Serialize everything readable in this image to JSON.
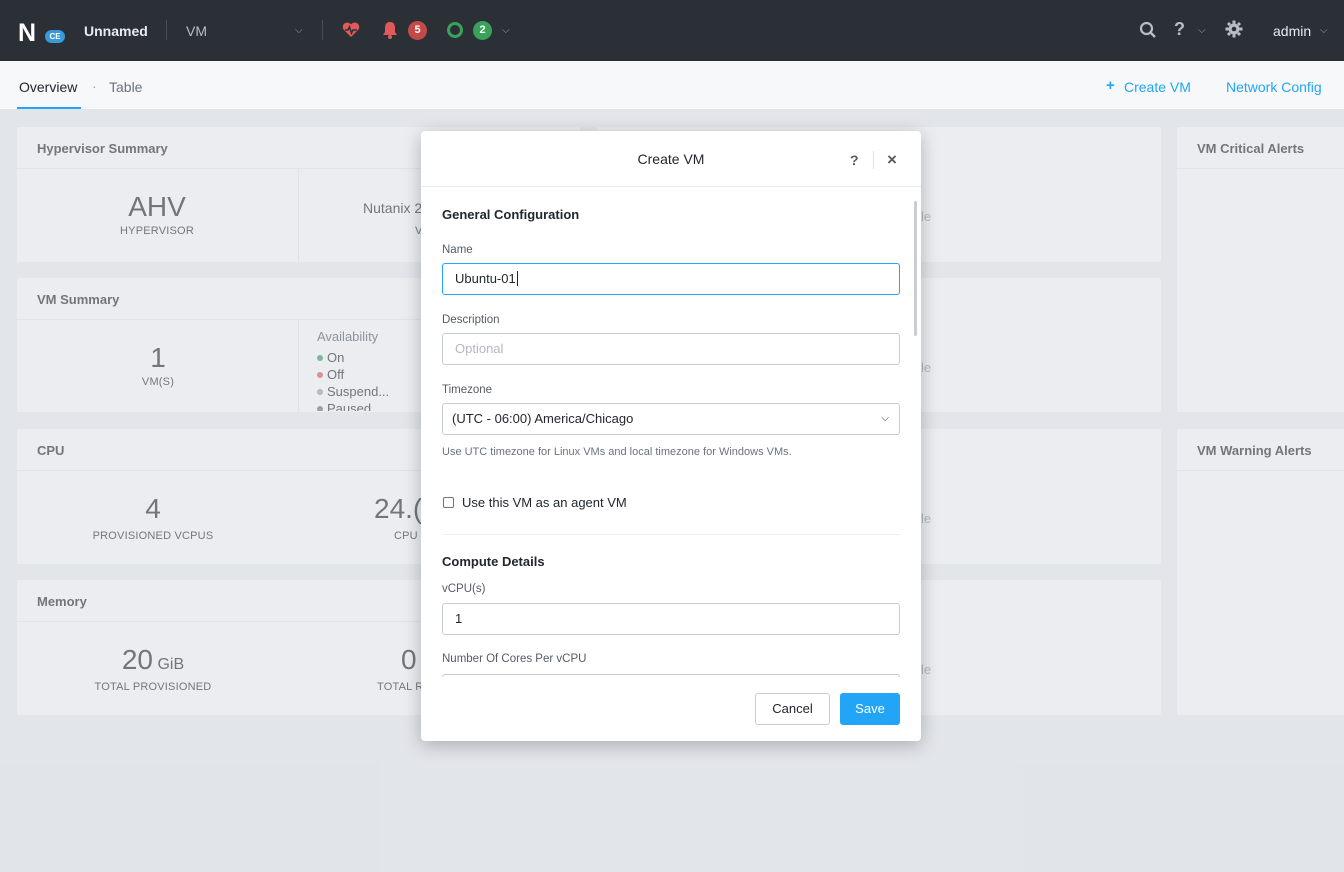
{
  "topbar": {
    "logo_letter": "N",
    "logo_badge": "CE",
    "cluster_name": "Unnamed",
    "section": "VM",
    "alerts_count": "5",
    "tasks_count": "2",
    "user": "admin"
  },
  "subnav": {
    "tabs": [
      {
        "label": "Overview"
      },
      {
        "label": "Table"
      }
    ],
    "separator": "·",
    "create_vm": "Create VM",
    "network_config": "Network Config"
  },
  "widgets": {
    "hypervisor": {
      "title": "Hypervisor Summary",
      "value": "AHV",
      "caption": "HYPERVISOR",
      "version_partial": "Nutanix 2",
      "version_caption_partial": "V"
    },
    "vm_summary": {
      "title": "VM Summary",
      "value": "1",
      "caption": "VM(S)",
      "availability_title": "Availability",
      "states": [
        "On",
        "Off",
        "Suspend...",
        "Paused"
      ]
    },
    "cpu": {
      "title": "CPU",
      "value": "4",
      "caption": "PROVISIONED VCPUS",
      "usage_partial": "24.(",
      "usage_caption_partial": "CPU"
    },
    "memory": {
      "title": "Memory",
      "value": "20",
      "unit": "GiB",
      "caption": "TOTAL PROVISIONED",
      "second_partial": "0",
      "second_caption_partial": "TOTAL R"
    },
    "right_ghost": [
      "le",
      "le",
      "le",
      "le"
    ],
    "critical_alerts": {
      "title": "VM Critical Alerts"
    },
    "warning_alerts": {
      "title": "VM Warning Alerts"
    }
  },
  "modal": {
    "title": "Create VM",
    "help": "?",
    "close": "×",
    "general_title": "General Configuration",
    "name_label": "Name",
    "name_value": "Ubuntu-01",
    "description_label": "Description",
    "description_placeholder": "Optional",
    "timezone_label": "Timezone",
    "timezone_value": "(UTC - 06:00) America/Chicago",
    "timezone_hint": "Use UTC timezone for Linux VMs and local timezone for Windows VMs.",
    "agent_vm_label": "Use this VM as an agent VM",
    "compute_title": "Compute Details",
    "vcpu_label": "vCPU(s)",
    "vcpu_value": "1",
    "cores_label": "Number Of Cores Per vCPU",
    "cancel": "Cancel",
    "save": "Save"
  },
  "colors": {
    "accent": "#22a5f7",
    "topbar": "#2b2f36",
    "alert_red": "#c44a4a",
    "ok_green": "#3aa15a"
  }
}
